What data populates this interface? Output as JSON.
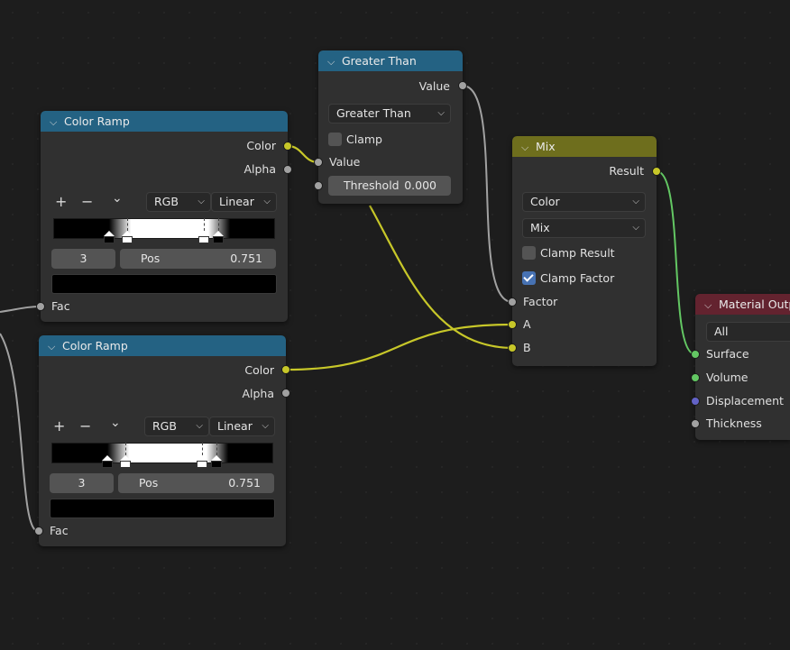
{
  "nodes": {
    "greater_than": {
      "title": "Greater Than",
      "output": "Value",
      "operation": "Greater Than",
      "clamp_label": "Clamp",
      "clamp_checked": false,
      "input_value": "Value",
      "threshold_label": "Threshold",
      "threshold_value": "0.000"
    },
    "color_ramp_1": {
      "title": "Color Ramp",
      "output_color": "Color",
      "output_alpha": "Alpha",
      "add": "+",
      "remove": "−",
      "menu": "⌄",
      "color_mode": "RGB",
      "interpolation": "Linear",
      "stop_index": "3",
      "pos_label": "Pos",
      "pos_value": "0.751",
      "input_fac": "Fac"
    },
    "color_ramp_2": {
      "title": "Color Ramp",
      "output_color": "Color",
      "output_alpha": "Alpha",
      "add": "+",
      "remove": "−",
      "menu": "⌄",
      "color_mode": "RGB",
      "interpolation": "Linear",
      "stop_index": "3",
      "pos_label": "Pos",
      "pos_value": "0.751",
      "input_fac": "Fac"
    },
    "mix": {
      "title": "Mix",
      "output": "Result",
      "data_type": "Color",
      "blend_mode": "Mix",
      "clamp_result_label": "Clamp Result",
      "clamp_result_checked": false,
      "clamp_factor_label": "Clamp Factor",
      "clamp_factor_checked": true,
      "input_factor": "Factor",
      "input_a": "A",
      "input_b": "B"
    },
    "material_output": {
      "title": "Material Outp",
      "target": "All",
      "input_surface": "Surface",
      "input_volume": "Volume",
      "input_displacement": "Displacement",
      "input_thickness": "Thickness"
    }
  },
  "colors": {
    "converter_header": "#246283",
    "mix_header": "#6e6e1d",
    "output_header": "#63232f",
    "socket_float": "#a1a1a1",
    "socket_color": "#c7c729",
    "socket_shader": "#63c763",
    "socket_vector": "#6363c7",
    "checkbox_on": "#4772b3"
  },
  "icons": {
    "collapse": "chevron-down-icon",
    "dropdown": "chevron-down-icon"
  }
}
